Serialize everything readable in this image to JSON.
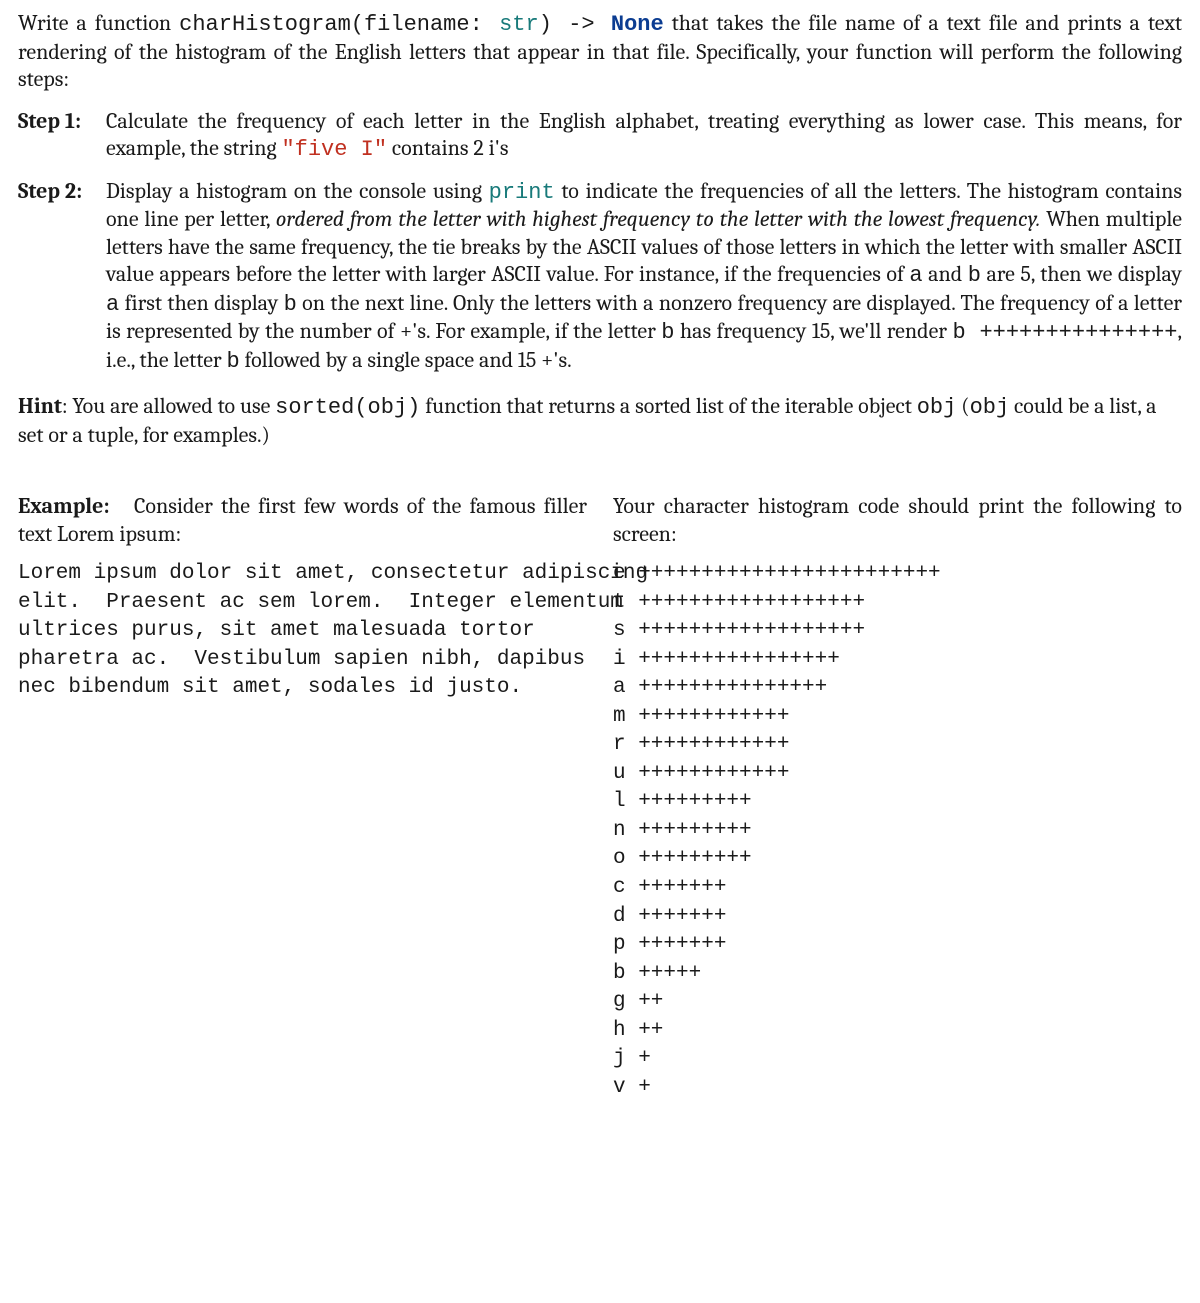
{
  "intro": {
    "pre": "Write a function ",
    "sig_name": "charHistogram(filename: ",
    "sig_type": "str",
    "sig_paren": ") ",
    "arrow": "-> ",
    "ret": "None",
    "post": " that takes the file name of a text file and prints a text rendering of the histogram of the English letters that appear in that file. Specifically, your function will perform the following steps:"
  },
  "step1": {
    "label": "Step 1:",
    "p1a": "Calculate the frequency of each letter in the English alphabet, treating everything as lower case. This means, for example, the string ",
    "code": "\"five I\"",
    "p1b": " contains 2 i's"
  },
  "step2": {
    "label": "Step 2:",
    "p1a": "Display a histogram on the console using ",
    "print_kw": "print",
    "p1b": " to indicate the frequencies of all the letters. The histogram contains one line per letter, ",
    "italic": "ordered from the letter with highest frequency to the letter with the lowest frequency.",
    "p1c": " When multiple letters have the same frequency, the tie breaks by the ASCII values of those letters in which the letter with smaller ASCII value appears before the letter with larger ASCII value. For instance, if the frequencies of ",
    "tt_a": "a",
    "p1d": " and ",
    "tt_b": "b",
    "p1e": " are 5, then we display ",
    "tt_a2": "a",
    "p1f": " first then display ",
    "tt_b2": "b",
    "p1g": " on the next line. Only the letters with a nonzero frequency are displayed. The frequency of a letter is represented by the number of +'s. For example, if the letter ",
    "tt_b3": "b",
    "p1h": " has frequency 15, we'll render ",
    "tt_render": "b  +++++++++++++++",
    "p1i": ", i.e., the letter ",
    "tt_b4": "b",
    "p1j": " followed by a single space and 15 +'s."
  },
  "hint": {
    "label": "Hint",
    "p1a": ": You are allowed to use ",
    "tt_sorted": "sorted(obj)",
    "p1b": " function that returns a sorted list of the iterable object ",
    "tt_obj": "obj",
    "p1c": " (",
    "tt_obj2": "obj",
    "p1d": " could be a list, a set or a tuple, for examples.)"
  },
  "example": {
    "left_label": "Example:",
    "left_text": "Consider the first few words of the fa­mous filler text Lorem ipsum:",
    "left_code": "Lorem ipsum dolor sit amet, consectetur adipiscing\nelit.  Praesent ac sem lorem.  Integer elementum\nultrices purus, sit amet malesuada tortor\npharetra ac.  Vestibulum sapien nibh, dapibus\nnec bibendum sit amet, sodales id justo.",
    "right_text": "Your character histogram code should print the following to screen:",
    "right_code": "e ++++++++++++++++++++++++\nt ++++++++++++++++++\ns ++++++++++++++++++\ni ++++++++++++++++\na +++++++++++++++\nm ++++++++++++\nr ++++++++++++\nu ++++++++++++\nl +++++++++\nn +++++++++\no +++++++++\nc +++++++\nd +++++++\np +++++++\nb +++++\ng ++\nh ++\nj +\nv +"
  }
}
